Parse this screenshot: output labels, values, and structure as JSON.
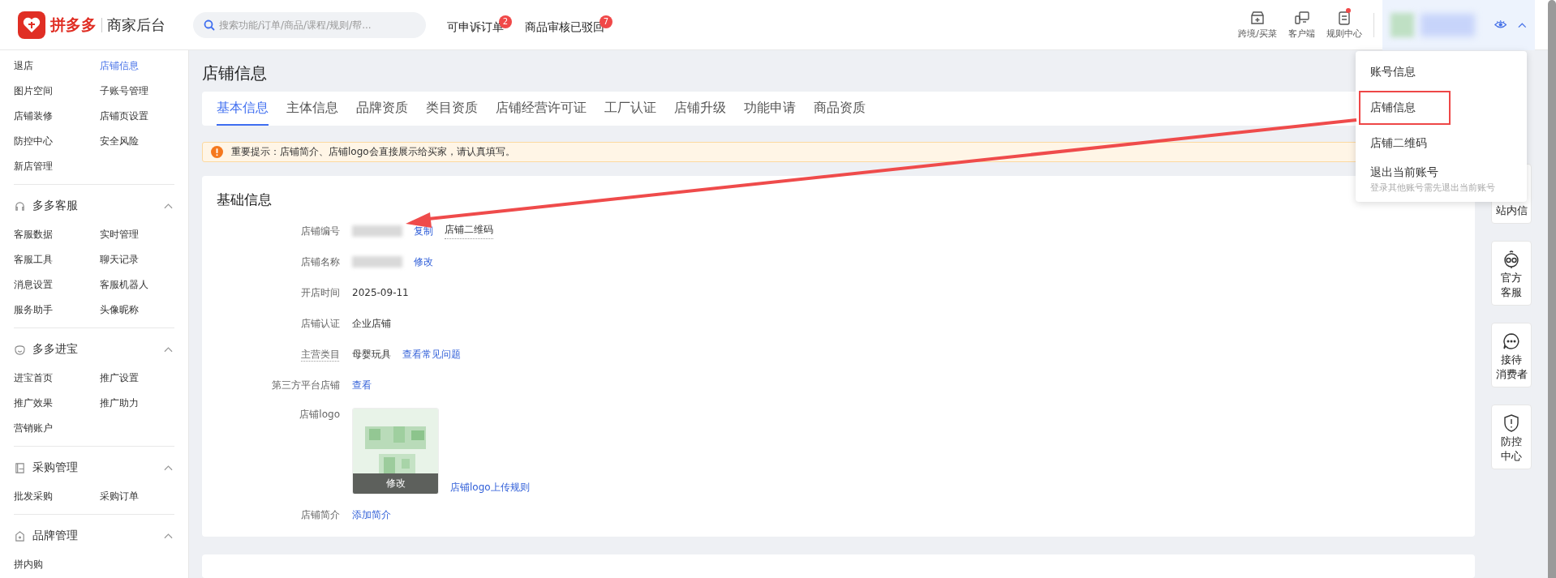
{
  "header": {
    "brand": "拼多多",
    "subtitle": "商家后台",
    "search": {
      "placeholder": "搜索功能/订单/商品/课程/规则/帮..."
    },
    "links": [
      {
        "label": "可申诉订单",
        "badge": "2"
      },
      {
        "label": "商品审核已驳回",
        "badge": "7"
      }
    ],
    "tools": [
      {
        "label": "跨境/买菜",
        "kind": "box",
        "dot": false
      },
      {
        "label": "客户端",
        "kind": "devices",
        "dot": false
      },
      {
        "label": "规则中心",
        "kind": "doc",
        "dot": true
      }
    ],
    "account": {
      "expanded": true
    }
  },
  "sidebar": {
    "sections": [
      {
        "items": [
          {
            "label": "退店",
            "selected": false
          },
          {
            "label": "店铺信息",
            "selected": true
          },
          {
            "label": "图片空间",
            "selected": false
          },
          {
            "label": "子账号管理",
            "selected": false
          },
          {
            "label": "店铺装修",
            "selected": false
          },
          {
            "label": "店铺页设置",
            "selected": false
          },
          {
            "label": "防控中心",
            "selected": false
          },
          {
            "label": "安全风险",
            "selected": false
          },
          {
            "label": "新店管理",
            "selected": false
          }
        ]
      },
      {
        "title": "多多客服",
        "expanded": true,
        "items": [
          {
            "label": "客服数据",
            "selected": false
          },
          {
            "label": "实时管理",
            "selected": false
          },
          {
            "label": "客服工具",
            "selected": false
          },
          {
            "label": "聊天记录",
            "selected": false
          },
          {
            "label": "消息设置",
            "selected": false
          },
          {
            "label": "客服机器人",
            "selected": false
          },
          {
            "label": "服务助手",
            "selected": false
          },
          {
            "label": "头像昵称",
            "selected": false
          }
        ]
      },
      {
        "title": "多多进宝",
        "expanded": true,
        "items": [
          {
            "label": "进宝首页",
            "selected": false
          },
          {
            "label": "推广设置",
            "selected": false
          },
          {
            "label": "推广效果",
            "selected": false
          },
          {
            "label": "推广助力",
            "selected": false
          },
          {
            "label": "营销账户",
            "selected": false
          }
        ]
      },
      {
        "title": "采购管理",
        "expanded": true,
        "items": [
          {
            "label": "批发采购",
            "selected": false
          },
          {
            "label": "采购订单",
            "selected": false
          }
        ]
      },
      {
        "title": "品牌管理",
        "expanded": true,
        "items": [
          {
            "label": "拼内购",
            "selected": false
          }
        ]
      }
    ]
  },
  "page_title": "店铺信息",
  "tabs": [
    {
      "label": "基本信息",
      "selected": true
    },
    {
      "label": "主体信息",
      "selected": false
    },
    {
      "label": "品牌资质",
      "selected": false
    },
    {
      "label": "类目资质",
      "selected": false
    },
    {
      "label": "店铺经营许可证",
      "selected": false
    },
    {
      "label": "工厂认证",
      "selected": false
    },
    {
      "label": "店铺升级",
      "selected": false
    },
    {
      "label": "功能申请",
      "selected": false
    },
    {
      "label": "商品资质",
      "selected": false
    }
  ],
  "notice": "重要提示：店铺简介、店铺logo会直接展示给买家，请认真填写。",
  "card": {
    "title": "基础信息",
    "fields": [
      {
        "label": "店铺编号",
        "kind": "redacted",
        "actions": [
          {
            "label": "复制",
            "kind": "link"
          },
          {
            "label": "店铺二维码",
            "kind": "dotted"
          }
        ]
      },
      {
        "label": "店铺名称",
        "kind": "redacted",
        "actions": [
          {
            "label": "修改",
            "kind": "link"
          }
        ]
      },
      {
        "label": "开店时间",
        "kind": "text",
        "value": "2025-09-11"
      },
      {
        "label": "店铺认证",
        "kind": "text",
        "value": "企业店铺"
      },
      {
        "label": "主营类目",
        "kind": "text",
        "hint": true,
        "value": "母婴玩具",
        "actions": [
          {
            "label": "查看常见问题",
            "kind": "link"
          }
        ]
      },
      {
        "label": "第三方平台店铺",
        "kind": "text",
        "actions": [
          {
            "label": "查看",
            "kind": "link"
          }
        ]
      },
      {
        "label": "店铺logo",
        "kind": "logo",
        "button": "修改",
        "actions": [
          {
            "label": "店铺logo上传规则",
            "kind": "link"
          }
        ]
      },
      {
        "label": "店铺简介",
        "kind": "text",
        "actions": [
          {
            "label": "添加简介",
            "kind": "link"
          }
        ]
      }
    ]
  },
  "side_buttons": [
    {
      "lines": [
        "站内信"
      ]
    },
    {
      "lines": [
        "官方",
        "客服"
      ]
    },
    {
      "lines": [
        "接待",
        "消费者"
      ]
    },
    {
      "lines": [
        "防控",
        "中心"
      ]
    }
  ],
  "dropdown": [
    {
      "label": "账号信息",
      "highlighted": false
    },
    {
      "label": "店铺信息",
      "highlighted": true
    },
    {
      "label": "店铺二维码",
      "highlighted": false
    },
    {
      "label": "退出当前账号",
      "note": "登录其他账号需先退出当前账号",
      "highlighted": false
    }
  ]
}
